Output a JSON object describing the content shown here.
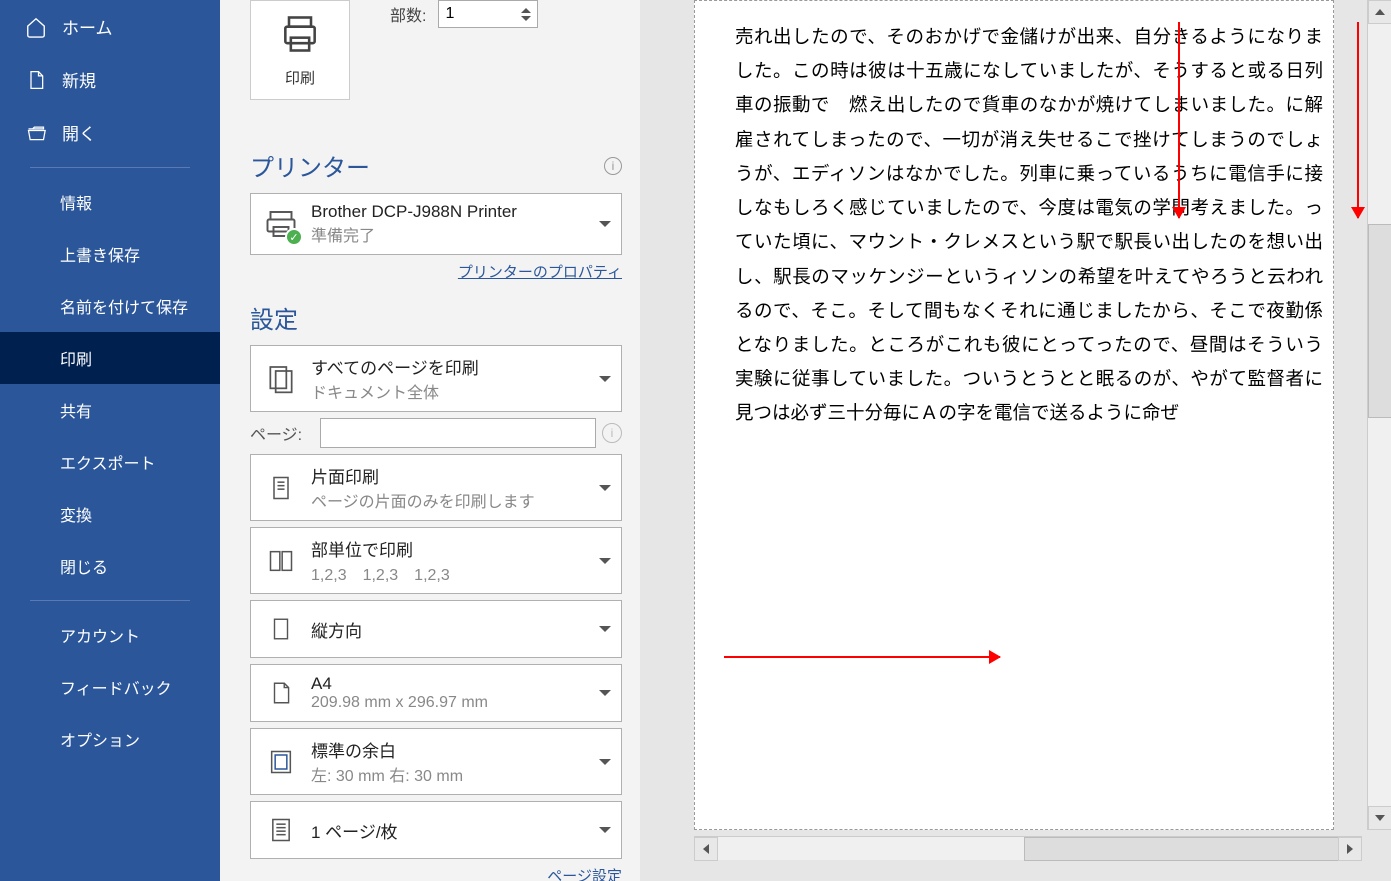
{
  "sidebar": {
    "home": "ホーム",
    "new": "新規",
    "open": "開く",
    "info": "情報",
    "save": "上書き保存",
    "saveas": "名前を付けて保存",
    "print": "印刷",
    "share": "共有",
    "export": "エクスポート",
    "transform": "変換",
    "close": "閉じる",
    "account": "アカウント",
    "feedback": "フィードバック",
    "options": "オプション"
  },
  "panel": {
    "copies_label": "部数:",
    "copies_value": "1",
    "print_label": "印刷",
    "printer_heading": "プリンター",
    "printer_name": "Brother DCP-J988N Printer",
    "printer_status": "準備完了",
    "printer_props": "プリンターのプロパティ",
    "settings_heading": "設定",
    "pages_all": "すべてのページを印刷",
    "pages_all_sub": "ドキュメント全体",
    "pages_label": "ページ:",
    "pages_value": "",
    "sided": "片面印刷",
    "sided_sub": "ページの片面のみを印刷します",
    "collate": "部単位で印刷",
    "collate_sub": "1,2,3　1,2,3　1,2,3",
    "orientation": "縦方向",
    "paper": "A4",
    "paper_sub": "209.98 mm x 296.97 mm",
    "margins": "標準の余白",
    "margins_sub": "左:  30 mm    右:  30 mm",
    "perpage": "1 ページ/枚",
    "page_setup": "ページ設定"
  },
  "preview": {
    "text": "売れ出したので、そのおかげで金儲けが出来、自分きるようになりました。この時は彼は十五歳になしていましたが、そうすると或る日列車の振動で　燃え出したので貨車のなかが焼けてしまいました。に解雇されてしまったので、一切が消え失せるこで挫けてしまうのでしょうが、エディソンはなかでした。列車に乗っているうちに電信手に接しなもしろく感じていましたので、今度は電気の学問考えました。っていた頃に、マウント・クレメスという駅で駅長い出したのを想い出し、駅長のマッケンジーというィソンの希望を叶えてやろうと云われるので、そこ。そして間もなくそれに通じましたから、そこで夜勤係となりました。ところがこれも彼にとってったので、昼間はそういう実験に従事していました。ついうとうとと眠るのが、やがて監督者に見つは必ず三十分毎にＡの字を電信で送るように命ぜ"
  }
}
